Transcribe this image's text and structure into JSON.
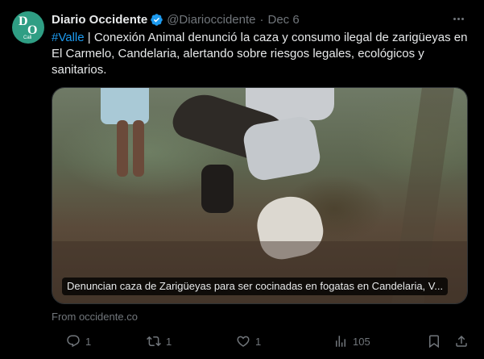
{
  "tweet": {
    "display_name": "Diario Occidente",
    "handle": "@Diarioccidente",
    "separator": "·",
    "date": "Dec 6",
    "avatar": {
      "letter_top": "D",
      "letter_bottom": "O",
      "small_text": "Cali"
    },
    "text": {
      "hashtag": "#Valle",
      "body": " | Conexión Animal denunció la caza y consumo ilegal de zarigüeyas en El Carmelo, Candelaria, alertando sobre riesgos legales, ecológicos y sanitarios."
    },
    "card": {
      "caption": "Denuncian caza de Zarigüeyas para ser cocinadas en fogatas en Candelaria, V..."
    },
    "source": "From occidente.co",
    "actions": {
      "replies": "1",
      "reposts": "1",
      "likes": "1",
      "views": "105"
    }
  },
  "colors": {
    "background": "#000000",
    "text_primary": "#e7e9ea",
    "text_secondary": "#71767b",
    "accent": "#1d9bf0"
  },
  "icons": [
    "verified-badge-icon",
    "more-icon",
    "reply-icon",
    "repost-icon",
    "like-icon",
    "views-icon",
    "bookmark-icon",
    "share-icon"
  ]
}
